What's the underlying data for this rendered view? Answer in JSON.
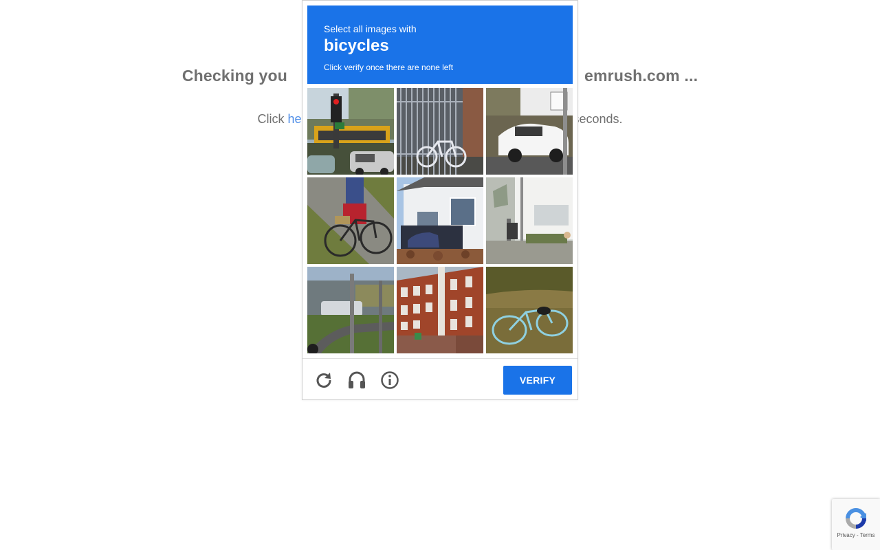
{
  "background_page": {
    "heading_left": "Checking you",
    "heading_right": "emrush.com ...",
    "sub_left": "Click ",
    "sub_link": "he",
    "sub_right": "seconds."
  },
  "challenge": {
    "instruction": "Select all images with",
    "target_word": "bicycles",
    "hint": "Click verify once there are none left",
    "tiles": [
      {
        "icon": "traffic-light-bus-car-image"
      },
      {
        "icon": "bicycle-behind-gate-image"
      },
      {
        "icon": "white-car-image"
      },
      {
        "icon": "person-riding-bicycle-image"
      },
      {
        "icon": "house-with-car-image"
      },
      {
        "icon": "white-building-street-image"
      },
      {
        "icon": "road-with-bus-image"
      },
      {
        "icon": "brick-building-image"
      },
      {
        "icon": "bicycle-on-grass-image"
      }
    ],
    "footer": {
      "reload_icon": "reload-icon",
      "audio_icon": "headphones-icon",
      "info_icon": "info-icon",
      "verify_label": "VERIFY"
    },
    "colors": {
      "header_bg": "#1a73e8",
      "verify_bg": "#1a73e8"
    }
  },
  "recaptcha_badge": {
    "links": "Privacy - Terms"
  }
}
